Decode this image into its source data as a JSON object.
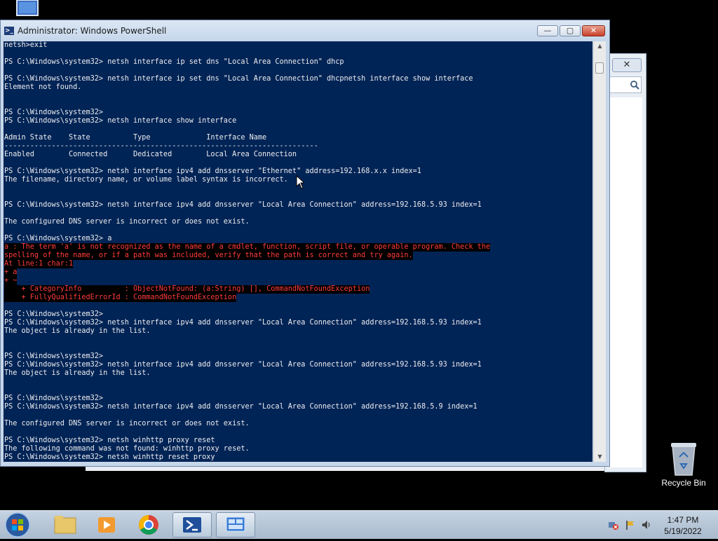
{
  "desktop": {
    "recycle_bin_label": "Recycle Bin"
  },
  "window": {
    "title": "Administrator: Windows PowerShell",
    "buttons": {
      "minimize": "—",
      "maximize": "▢",
      "close": "✕"
    }
  },
  "console": {
    "lines": [
      {
        "text": "netsh>exit",
        "type": "normal"
      },
      {
        "text": "",
        "type": "normal"
      },
      {
        "text": "PS C:\\Windows\\system32> netsh interface ip set dns \"Local Area Connection\" dhcp",
        "type": "normal"
      },
      {
        "text": "",
        "type": "normal"
      },
      {
        "text": "PS C:\\Windows\\system32> netsh interface ip set dns \"Local Area Connection\" dhcpnetsh interface show interface",
        "type": "normal"
      },
      {
        "text": "Element not found.",
        "type": "normal"
      },
      {
        "text": "",
        "type": "normal"
      },
      {
        "text": "",
        "type": "normal"
      },
      {
        "text": "PS C:\\Windows\\system32>",
        "type": "normal"
      },
      {
        "text": "PS C:\\Windows\\system32> netsh interface show interface",
        "type": "normal"
      },
      {
        "text": "",
        "type": "normal"
      },
      {
        "text": "Admin State    State          Type             Interface Name",
        "type": "normal"
      },
      {
        "text": "-------------------------------------------------------------------------",
        "type": "normal"
      },
      {
        "text": "Enabled        Connected      Dedicated        Local Area Connection",
        "type": "normal"
      },
      {
        "text": "",
        "type": "normal"
      },
      {
        "text": "PS C:\\Windows\\system32> netsh interface ipv4 add dnsserver \"Ethernet\" address=192.168.x.x index=1",
        "type": "normal"
      },
      {
        "text": "The filename, directory name, or volume label syntax is incorrect.",
        "type": "normal"
      },
      {
        "text": "",
        "type": "normal"
      },
      {
        "text": "",
        "type": "normal"
      },
      {
        "text": "PS C:\\Windows\\system32> netsh interface ipv4 add dnsserver \"Local Area Connection\" address=192.168.5.93 index=1",
        "type": "normal"
      },
      {
        "text": "",
        "type": "normal"
      },
      {
        "text": "The configured DNS server is incorrect or does not exist.",
        "type": "normal"
      },
      {
        "text": "",
        "type": "normal"
      },
      {
        "text": "PS C:\\Windows\\system32> a",
        "type": "normal"
      },
      {
        "text": "a : The term 'a' is not recognized as the name of a cmdlet, function, script file, or operable program. Check the",
        "type": "err"
      },
      {
        "text": "spelling of the name, or if a path was included, verify that the path is correct and try again.",
        "type": "err"
      },
      {
        "text": "At line:1 char:1",
        "type": "err"
      },
      {
        "text": "+ a",
        "type": "err"
      },
      {
        "text": "+ ~",
        "type": "err"
      },
      {
        "text": "    + CategoryInfo          : ObjectNotFound: (a:String) [], CommandNotFoundException",
        "type": "err"
      },
      {
        "text": "    + FullyQualifiedErrorId : CommandNotFoundException",
        "type": "err"
      },
      {
        "text": "",
        "type": "normal"
      },
      {
        "text": "PS C:\\Windows\\system32>",
        "type": "normal"
      },
      {
        "text": "PS C:\\Windows\\system32> netsh interface ipv4 add dnsserver \"Local Area Connection\" address=192.168.5.93 index=1",
        "type": "normal"
      },
      {
        "text": "The object is already in the list.",
        "type": "normal"
      },
      {
        "text": "",
        "type": "normal"
      },
      {
        "text": "",
        "type": "normal"
      },
      {
        "text": "PS C:\\Windows\\system32>",
        "type": "normal"
      },
      {
        "text": "PS C:\\Windows\\system32> netsh interface ipv4 add dnsserver \"Local Area Connection\" address=192.168.5.93 index=1",
        "type": "normal"
      },
      {
        "text": "The object is already in the list.",
        "type": "normal"
      },
      {
        "text": "",
        "type": "normal"
      },
      {
        "text": "",
        "type": "normal"
      },
      {
        "text": "PS C:\\Windows\\system32>",
        "type": "normal"
      },
      {
        "text": "PS C:\\Windows\\system32> netsh interface ipv4 add dnsserver \"Local Area Connection\" address=192.168.5.9 index=1",
        "type": "normal"
      },
      {
        "text": "",
        "type": "normal"
      },
      {
        "text": "The configured DNS server is incorrect or does not exist.",
        "type": "normal"
      },
      {
        "text": "",
        "type": "normal"
      },
      {
        "text": "PS C:\\Windows\\system32> netsh winhttp proxy reset",
        "type": "normal"
      },
      {
        "text": "The following command was not found: winhttp proxy reset.",
        "type": "normal"
      },
      {
        "text": "PS C:\\Windows\\system32> netsh winhttp reset proxy",
        "type": "normal"
      }
    ]
  },
  "taskbar": {
    "apps": [
      {
        "name": "start-button",
        "icon": "windows-orb-icon"
      },
      {
        "name": "taskbar-explorer",
        "icon": "folder-icon"
      },
      {
        "name": "taskbar-media-player",
        "icon": "media-player-icon"
      },
      {
        "name": "taskbar-chrome",
        "icon": "chrome-icon"
      },
      {
        "name": "taskbar-powershell",
        "icon": "powershell-icon"
      },
      {
        "name": "taskbar-remote-desktop",
        "icon": "remote-desktop-icon"
      }
    ],
    "clock": {
      "time": "1:47 PM",
      "date": "5/19/2022"
    }
  },
  "colors": {
    "console_bg": "#012456",
    "console_fg": "#eeedf0",
    "error_fg": "#ff3c3c",
    "error_bg": "#000000"
  }
}
